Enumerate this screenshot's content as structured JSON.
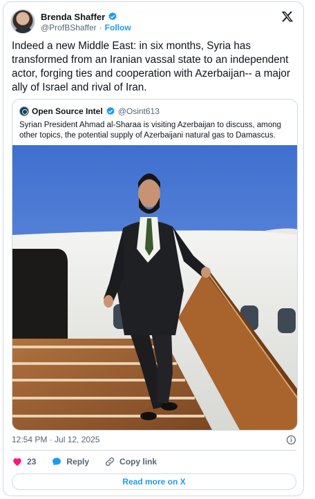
{
  "author": {
    "display_name": "Brenda Shaffer",
    "handle": "@ProfBShaffer",
    "separator": "·",
    "follow_label": "Follow"
  },
  "tweet": {
    "text": "Indeed a new Middle East: in six months, Syria has transformed from an Iranian vassal state to an independent actor, forging ties and cooperation with Azerbaijan-- a major ally of Israel  and rival of Iran.",
    "timestamp": "12:54 PM · Jul 12, 2025"
  },
  "quote": {
    "display_name": "Open Source Intel",
    "handle": "@Osint613",
    "text": "Syrian President Ahmad al-Sharaa is visiting Azerbaijan to discuss, among other topics, the potential supply of Azerbaijani natural gas to Damascus."
  },
  "actions": {
    "like_count": "23",
    "reply_label": "Reply",
    "copy_label": "Copy link"
  },
  "read_more_label": "Read more on X",
  "icons": {
    "verified": "verified-badge-icon",
    "x_logo": "x-logo-icon",
    "info": "info-icon",
    "like": "heart-icon",
    "reply": "reply-bubble-icon",
    "copy": "link-icon"
  },
  "colors": {
    "accent": "#1d9bf0",
    "like": "#f91880",
    "border": "#cfd9de",
    "muted": "#536471"
  }
}
